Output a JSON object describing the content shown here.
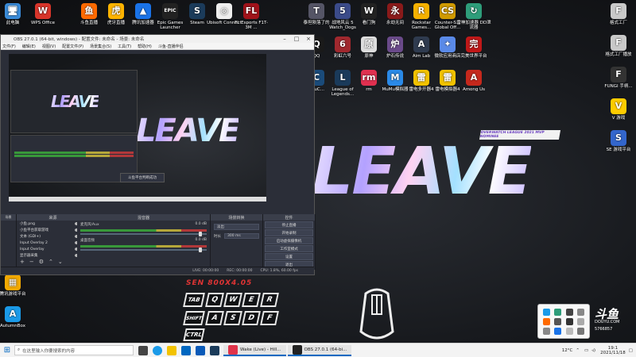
{
  "desktop_icons_left": [
    {
      "label": "此电脑",
      "color": "#3a8bd8",
      "glyph": "🖥"
    },
    {
      "label": "WPS Office",
      "color": "#d8352a",
      "glyph": "W"
    }
  ],
  "desktop_icons_top": [
    {
      "label": "斗鱼直播",
      "color": "#ff6a00",
      "glyph": "鱼"
    },
    {
      "label": "虎牙直播",
      "color": "#ffb400",
      "glyph": "虎"
    },
    {
      "label": "腾讯加速器",
      "color": "#1a73e8",
      "glyph": "▲"
    },
    {
      "label": "Epic Games Launcher",
      "color": "#222",
      "glyph": "EPIC"
    },
    {
      "label": "Steam",
      "color": "#1b3b5a",
      "glyph": "S"
    },
    {
      "label": "Ubisoft Connect",
      "color": "#eee",
      "glyph": "◎"
    },
    {
      "label": "FL Esports F1T-3M ...",
      "color": "#a0121a",
      "glyph": "FL"
    }
  ],
  "desktop_icons_top_right": [
    {
      "label": "泰坦陨落了的",
      "color": "#556",
      "glyph": "T"
    },
    {
      "label": "战地风云 5 Watch_Dogs",
      "color": "#3b4b8a",
      "glyph": "5"
    },
    {
      "label": "看门狗",
      "color": "#222",
      "glyph": "W"
    },
    {
      "label": "永劫无间",
      "color": "#8a1a1a",
      "glyph": "永"
    },
    {
      "label": "Rockstar Games...",
      "color": "#f6b100",
      "glyph": "R"
    },
    {
      "label": "Counter-S... Global Off...",
      "color": "#d09a00",
      "glyph": "CS"
    },
    {
      "label": "雷神加速器 DD泄流器",
      "color": "#2e9d7a",
      "glyph": "↻"
    }
  ],
  "desktop_icons_row2": [
    {
      "label": "QQ",
      "color": "#1a1a1a",
      "glyph": "Q"
    },
    {
      "label": "彩虹六号",
      "color": "#a0282e",
      "glyph": "6"
    },
    {
      "label": "原神",
      "color": "#dedede",
      "glyph": "原"
    },
    {
      "label": "炉石传说",
      "color": "#6a4a8a",
      "glyph": "炉"
    },
    {
      "label": "Aim Lab",
      "color": "#2f3b4f",
      "glyph": "A"
    },
    {
      "label": "微软应用商店",
      "color": "#5a8ae8",
      "glyph": "✦"
    },
    {
      "label": "完美世界平台",
      "color": "#c01818",
      "glyph": "完"
    }
  ],
  "desktop_icons_row3": [
    {
      "label": "ChuC...",
      "color": "#1a4b7a",
      "glyph": "C"
    },
    {
      "label": "League of Legends...",
      "color": "#1a3a5a",
      "glyph": "L"
    },
    {
      "label": "rm",
      "color": "#e03050",
      "glyph": "rm"
    },
    {
      "label": "MuMu模拟器",
      "color": "#2a8ae8",
      "glyph": "M"
    },
    {
      "label": "雷电多开器4",
      "color": "#f2c200",
      "glyph": "雷"
    },
    {
      "label": "雷电模拟器4",
      "color": "#f2c200",
      "glyph": "雷"
    },
    {
      "label": "Among Us",
      "color": "#c5281c",
      "glyph": "A"
    }
  ],
  "desktop_icons_right": [
    {
      "label": "格式工厂",
      "color": "#c9c9c9",
      "glyph": "F"
    },
    {
      "label": "格式工厂播放",
      "color": "#c9c9c9",
      "glyph": "F"
    },
    {
      "label": "FUNGI 手柄...",
      "color": "#333",
      "glyph": "F"
    },
    {
      "label": "V 游戏",
      "color": "#ffcc00",
      "glyph": "V"
    },
    {
      "label": "SE 游戏平台",
      "color": "#3366cc",
      "glyph": "S"
    }
  ],
  "desktop_icons_left_bottom": [
    {
      "label": "腾讯游戏平台",
      "color": "#f2a900",
      "glyph": "▦"
    },
    {
      "label": "AutumnBox",
      "color": "#1a9ae8",
      "glyph": "A"
    }
  ],
  "logo_text": "LEAVE",
  "badge_text": "OVERWATCH LEAGUE 2021 MVP NOMINEE",
  "overlay_streamer_text": "SEN 800X4.05",
  "keys": {
    "tab": "TAB",
    "q": "Q",
    "w": "W",
    "e": "E",
    "r": "R",
    "shift": "SHIFT",
    "a": "A",
    "s": "S",
    "d": "D",
    "f": "F",
    "ctrl": "CTRL"
  },
  "obs": {
    "title": "OBS 27.0.1 (64-bit, windows) - 配置文件: 未命名 - 场景: 未命名",
    "menu": [
      "文件(F)",
      "编辑(E)",
      "视图(V)",
      "配置文件(P)",
      "场景集合(S)",
      "工具(T)",
      "帮助(H)",
      "斗鱼-直播伴侣"
    ],
    "notification": "斗鱼平台判断成功",
    "preview_tabs": [
      "预览",
      "查看"
    ],
    "panels": {
      "scenes": "场景",
      "sources": "来源",
      "mixer": "混音器",
      "transitions": "场景转换",
      "controls": "控件"
    },
    "sources": [
      {
        "name": "小鱼.png"
      },
      {
        "name": "小鱼平台获取游戏"
      },
      {
        "name": "文本 (GDI+)"
      },
      {
        "name": "Input Overlay 2"
      },
      {
        "name": "Input Overlay"
      },
      {
        "name": "显示器采集"
      }
    ],
    "mixer": [
      {
        "name": "麦克风/Aux",
        "level": "0.0 dB"
      },
      {
        "name": "桌面音频",
        "level": "0.0 dB"
      }
    ],
    "transition": {
      "type": "淡出",
      "duration_label": "时长",
      "duration": "300 ms"
    },
    "controls": [
      "停止直播",
      "开始录制",
      "启动虚拟摄像机",
      "工作室模式",
      "设置",
      "退出"
    ],
    "status": {
      "live": "LIVE: 00:00:00",
      "rec": "REC: 00:00:00",
      "cpu": "CPU: 1.8%, 60.00 fps"
    }
  },
  "taskbar": {
    "search_placeholder": "在这里输入你要搜索的内容",
    "apps": [
      {
        "label": "Wake (Live) - Hill...",
        "color": "#e0334a"
      },
      {
        "label": "OBS 27.0.1 (64-bi...",
        "color": "#222"
      }
    ],
    "temperature": "12°C",
    "time": "19:1",
    "date": "2021/11/18"
  },
  "watermark": {
    "brand": "斗鱼",
    "sub": "DOUYU.COM",
    "room": "5766857"
  }
}
